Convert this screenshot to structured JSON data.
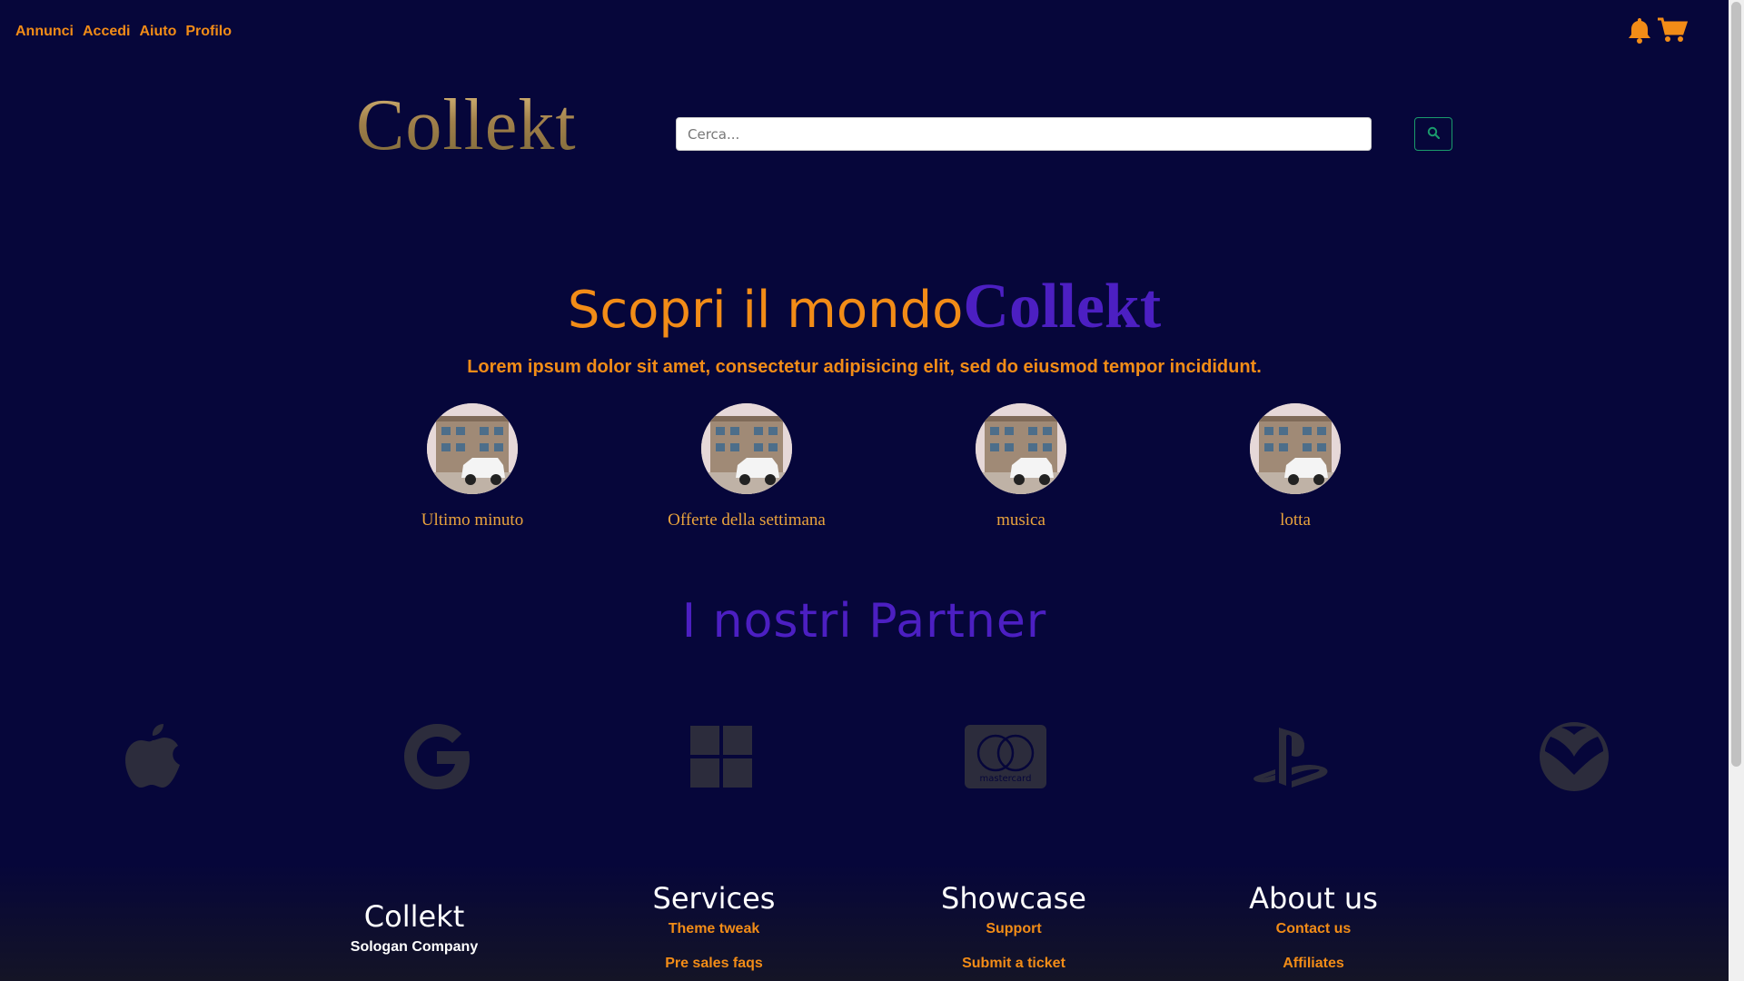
{
  "nav": {
    "items": [
      "Annunci",
      "Accedi",
      "Aiuto",
      "Profilo"
    ]
  },
  "icons": {
    "notifications": "bell-icon",
    "cart": "cart-icon",
    "search": "search-icon"
  },
  "header": {
    "logo": "Collekt"
  },
  "search": {
    "placeholder": "Cerca...",
    "value": ""
  },
  "hero": {
    "title_text": "Scopri il mondo",
    "title_brand": "Collekt",
    "subtitle": "Lorem ipsum dolor sit amet, consectetur adipisicing elit, sed do eiusmod tempor incididunt."
  },
  "categories": [
    {
      "label": "Ultimo minuto"
    },
    {
      "label": "Offerte della settimana"
    },
    {
      "label": "musica"
    },
    {
      "label": "lotta"
    }
  ],
  "partners": {
    "title": "I nostri Partner",
    "logos": [
      "apple-logo",
      "google-logo",
      "windows-logo",
      "mastercard-logo",
      "playstation-logo",
      "xbox-logo"
    ],
    "mastercard_text": "mastercard"
  },
  "footer": {
    "brand": {
      "title": "Collekt",
      "slogan": "Sologan Company"
    },
    "columns": [
      {
        "title": "Services",
        "links": [
          "Theme tweak",
          "Pre sales faqs"
        ]
      },
      {
        "title": "Showcase",
        "links": [
          "Support",
          "Submit a ticket"
        ]
      },
      {
        "title": "About us",
        "links": [
          "Contact us",
          "Affiliates"
        ]
      }
    ]
  },
  "colors": {
    "background": "#06063a",
    "accent": "#f28c17",
    "brand_purple": "#4c1fc2",
    "logo_gold": "#a07f4a",
    "partner_gray": "#2c2c3c"
  }
}
